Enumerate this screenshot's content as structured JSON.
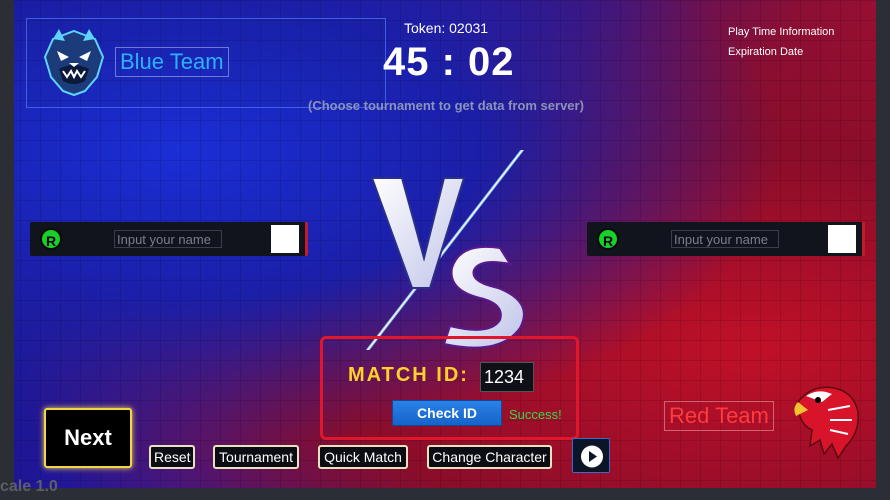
{
  "blue_team": {
    "name": "Blue Team"
  },
  "header": {
    "token": "Token: 02031",
    "timer": "45 : 02",
    "tournament_hint": "(Choose tournament to get data from server)"
  },
  "info": {
    "play_time": "Play Time Information",
    "expiration": "Expiration Date"
  },
  "player_left": {
    "badge": "R",
    "placeholder": "Input your name"
  },
  "player_right": {
    "badge": "R",
    "placeholder": "Input your name"
  },
  "match": {
    "label": "MATCH ID:",
    "value": "1234",
    "check_label": "Check ID",
    "status": "Success!"
  },
  "red_team": {
    "name": "Red Team"
  },
  "controls": {
    "next": "Next",
    "reset": "Reset",
    "tournament": "Tournament",
    "quick_match": "Quick Match",
    "change_character": "Change Character",
    "play_icon": "play-icon"
  },
  "footer": {
    "version": "cale 1.0"
  },
  "colors": {
    "blue_team": "#2fb0ff",
    "red_team": "#ff3b3b",
    "match_label": "#ffd12a",
    "success": "#34d84a",
    "highlight_box": "#e0162c"
  }
}
